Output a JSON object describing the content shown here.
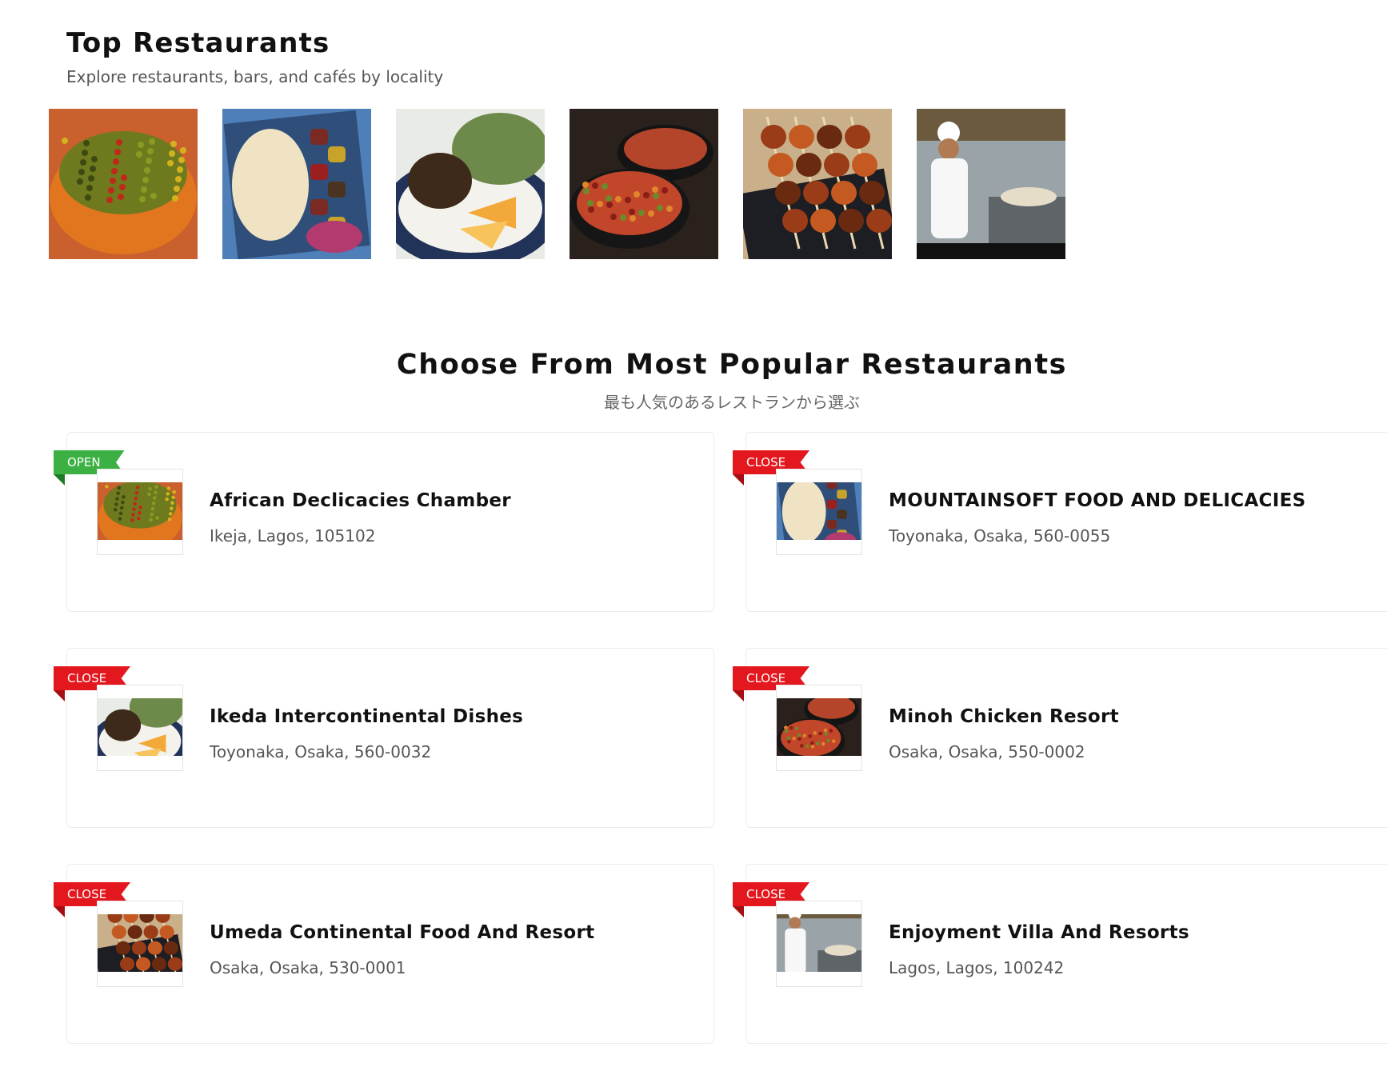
{
  "top_restaurants": {
    "title": "Top Restaurants",
    "subtitle": "Explore restaurants, bars, and cafés by locality",
    "gallery": [
      {
        "name": "african-dish-photo",
        "theme": "orange-pot"
      },
      {
        "name": "rice-and-kebab-photo",
        "theme": "blue-plate"
      },
      {
        "name": "fish-and-orange-photo",
        "theme": "white-plate"
      },
      {
        "name": "red-stew-photo",
        "theme": "dark-bowl"
      },
      {
        "name": "chicken-skewers-photo",
        "theme": "skewers"
      },
      {
        "name": "chef-kitchen-photo",
        "theme": "kitchen"
      }
    ]
  },
  "popular": {
    "title": "Choose From Most Popular Restaurants",
    "subtitle": "最も人気のあるレストランから選ぶ",
    "restaurants": [
      {
        "name": "African Declicacies Chamber",
        "address": "Ikeja, Lagos, 105102",
        "status": "OPEN",
        "status_color": "#3cb043",
        "theme": "orange-pot"
      },
      {
        "name": "MOUNTAINSOFT FOOD AND DELICACIES",
        "address": "Toyonaka, Osaka, 560-0055",
        "status": "CLOSE",
        "status_color": "#e3171e",
        "theme": "blue-plate"
      },
      {
        "name": "Ikeda Intercontinental Dishes",
        "address": "Toyonaka, Osaka, 560-0032",
        "status": "CLOSE",
        "status_color": "#e3171e",
        "theme": "white-plate"
      },
      {
        "name": "Minoh Chicken Resort",
        "address": "Osaka, Osaka, 550-0002",
        "status": "CLOSE",
        "status_color": "#e3171e",
        "theme": "dark-bowl"
      },
      {
        "name": "Umeda Continental Food And Resort",
        "address": "Osaka, Osaka, 530-0001",
        "status": "CLOSE",
        "status_color": "#e3171e",
        "theme": "skewers"
      },
      {
        "name": "Enjoyment Villa And Resorts",
        "address": "Lagos, Lagos, 100242",
        "status": "CLOSE",
        "status_color": "#e3171e",
        "theme": "kitchen"
      }
    ]
  }
}
